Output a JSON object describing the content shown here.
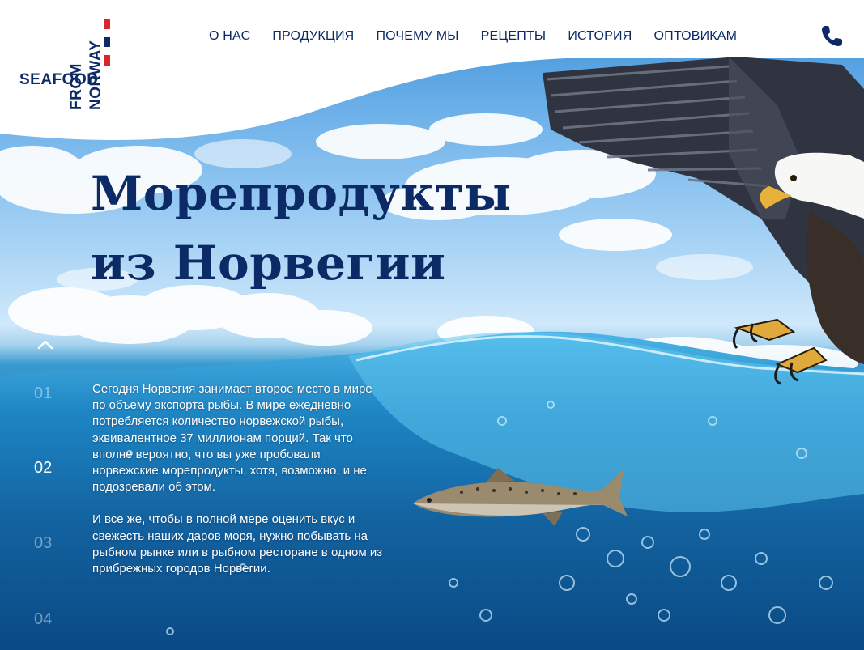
{
  "brand": {
    "logo_text": "SEAFOOD FROM NORWAY",
    "logo_words": [
      "SEAFOOD",
      "FROM",
      "NORWAY"
    ],
    "colors": {
      "navy": "#0e2a66",
      "red": "#d9262c"
    }
  },
  "nav": {
    "items": [
      {
        "label": "О НАС"
      },
      {
        "label": "ПРОДУКЦИЯ"
      },
      {
        "label": "ПОЧЕМУ МЫ"
      },
      {
        "label": "РЕЦЕПТЫ"
      },
      {
        "label": "ИСТОРИЯ"
      },
      {
        "label": "ОПТОВИКАМ"
      }
    ],
    "phone_icon": "phone-icon"
  },
  "hero": {
    "title_line1": "Морепродукты",
    "title_line2": "из Норвегии",
    "paragraph1": "Сегодня Норвегия занимает второе место в мире по объему экспорта рыбы. В мире ежедневно потребляется количество норвежской рыбы, эквивалентное 37 миллионам порций. Так что вполне вероятно, что вы уже пробовали норвежские морепродукты, хотя, возможно, и не подозревали об этом.",
    "paragraph2": "И все же, чтобы в полной мере оценить вкус и свежесть наших даров моря, нужно побывать на рыбном рынке или в рыбном ресторане в одном из прибрежных городов Норвегии."
  },
  "slider": {
    "up_icon": "chevron-up-icon",
    "numbers": [
      "01",
      "02",
      "03",
      "04"
    ],
    "active": "02"
  }
}
